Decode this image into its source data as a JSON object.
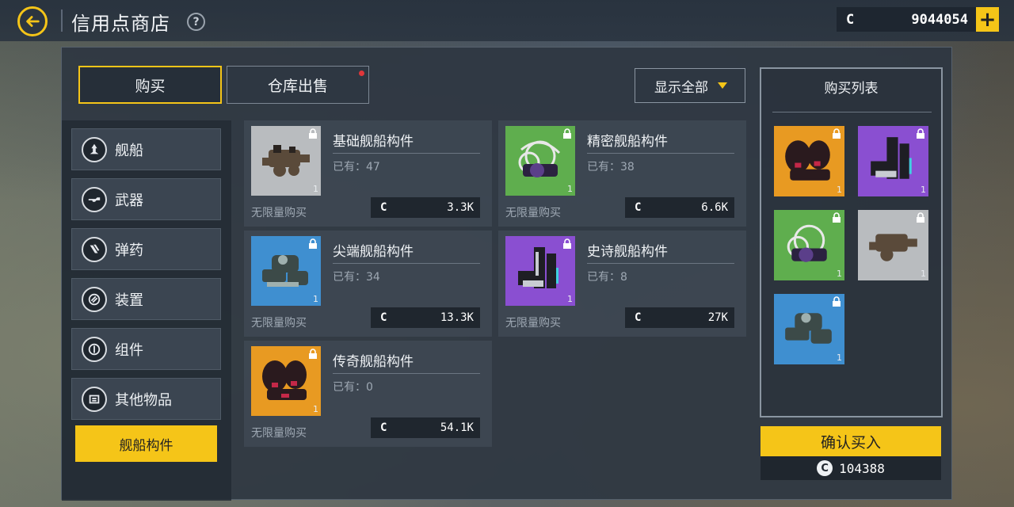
{
  "header": {
    "title": "信用点商店",
    "help": "?",
    "currency_symbol": "C",
    "currency_value": "9044054",
    "add": "+"
  },
  "tabs": [
    {
      "label": "购买",
      "active": true
    },
    {
      "label": "仓库出售",
      "active": false,
      "notification": true
    }
  ],
  "filter": {
    "label": "显示全部"
  },
  "sidebar": {
    "items": [
      {
        "label": "舰船",
        "icon": "ship-icon"
      },
      {
        "label": "武器",
        "icon": "weapon-icon"
      },
      {
        "label": "弹药",
        "icon": "ammo-icon"
      },
      {
        "label": "装置",
        "icon": "device-icon"
      },
      {
        "label": "组件",
        "icon": "component-icon"
      },
      {
        "label": "其他物品",
        "icon": "misc-icon"
      }
    ],
    "active_sub": "舰船构件"
  },
  "items": [
    {
      "name": "基础舰船构件",
      "owned": "已有：47",
      "limit": "无限量购买",
      "currency": "C",
      "price": "3.3K",
      "qty": "1",
      "bg": "#b9bcbf"
    },
    {
      "name": "精密舰船构件",
      "owned": "已有：38",
      "limit": "无限量购买",
      "currency": "C",
      "price": "6.6K",
      "qty": "1",
      "bg": "#5fae4e"
    },
    {
      "name": "尖端舰船构件",
      "owned": "已有：34",
      "limit": "无限量购买",
      "currency": "C",
      "price": "13.3K",
      "qty": "1",
      "bg": "#3f8fd0"
    },
    {
      "name": "史诗舰船构件",
      "owned": "已有：8",
      "limit": "无限量购买",
      "currency": "C",
      "price": "27K",
      "qty": "1",
      "bg": "#8a4fd1"
    },
    {
      "name": "传奇舰船构件",
      "owned": "已有：0",
      "limit": "无限量购买",
      "currency": "C",
      "price": "54.1K",
      "qty": "1",
      "bg": "#e89a22"
    }
  ],
  "purchase_list": {
    "title": "购买列表",
    "items": [
      {
        "qty": "1",
        "bg": "#e89a22"
      },
      {
        "qty": "1",
        "bg": "#8a4fd1"
      },
      {
        "qty": "1",
        "bg": "#5fae4e"
      },
      {
        "qty": "1",
        "bg": "#b9bcbf"
      },
      {
        "qty": "1",
        "bg": "#3f8fd0"
      }
    ],
    "confirm_label": "确认买入",
    "total_symbol": "C",
    "total": "104388"
  }
}
